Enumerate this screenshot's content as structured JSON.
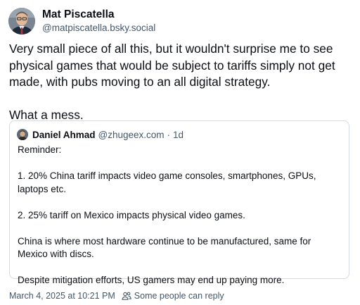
{
  "post": {
    "author_name": "Mat Piscatella",
    "author_handle": "@matpiscatella.bsky.social",
    "paragraphs": [
      "Very small piece of all this, but it wouldn't surprise me to see physical games that would be subject to tariffs simply not get made, with pubs moving to an all digital strategy.",
      "What a mess."
    ]
  },
  "quote": {
    "author_name": "Daniel Ahmad",
    "author_handle": "@zhugeex.com",
    "separator": "·",
    "time_ago": "1d",
    "paragraphs": [
      "Reminder:",
      "1. 20% China tariff impacts video game consoles, smartphones, GPUs, laptops etc.",
      "2. 25% tariff on Mexico impacts physical video games.",
      "China is where most hardware continue to be manufactured, same for Mexico with discs.",
      "Despite mitigation efforts, US gamers may end up paying more."
    ]
  },
  "footer": {
    "timestamp": "March 4, 2025 at 10:21 PM",
    "reply_setting_icon": "people-icon",
    "reply_setting": "Some people can reply"
  },
  "colors": {
    "text_primary": "#0b0f14",
    "text_secondary": "#42576c",
    "border": "#d4dbe2",
    "background": "#ffffff"
  }
}
